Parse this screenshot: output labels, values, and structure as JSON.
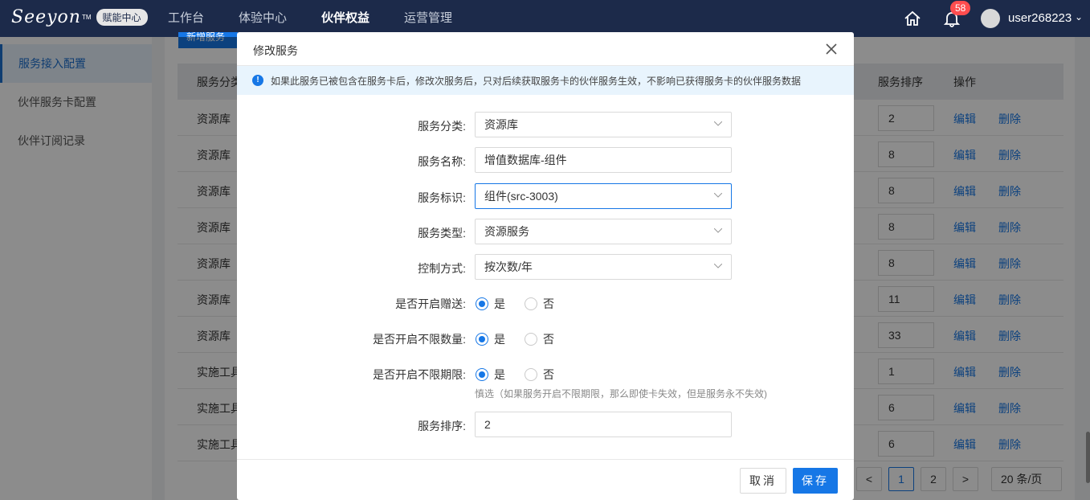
{
  "brand": {
    "logo_text": "Seeyon",
    "tm": "TM",
    "badge": "赋能中心"
  },
  "nav": [
    {
      "label": "工作台"
    },
    {
      "label": "体验中心"
    },
    {
      "label": "伙伴权益"
    },
    {
      "label": "运营管理"
    }
  ],
  "header": {
    "notification_count": "58",
    "username": "user268223"
  },
  "sidebar": {
    "items": [
      {
        "label": "服务接入配置",
        "active": true
      },
      {
        "label": "伙伴服务卡配置"
      },
      {
        "label": "伙伴订阅记录"
      }
    ]
  },
  "page": {
    "add_button": "新增服务",
    "columns": {
      "category": "服务分类",
      "sort": "服务排序",
      "ops": "操作"
    },
    "rows": [
      {
        "category": "资源库",
        "sort": "2"
      },
      {
        "category": "资源库",
        "sort": "8"
      },
      {
        "category": "资源库",
        "sort": "8"
      },
      {
        "category": "资源库",
        "sort": "8"
      },
      {
        "category": "资源库",
        "sort": "8"
      },
      {
        "category": "资源库",
        "sort": "11"
      },
      {
        "category": "资源库",
        "sort": "33"
      },
      {
        "category": "实施工具",
        "sort": "1"
      },
      {
        "category": "实施工具",
        "sort": "6"
      },
      {
        "category": "实施工具",
        "sort": "6"
      }
    ],
    "edit_label": "编辑",
    "delete_label": "删除",
    "pagination": {
      "prev": "<",
      "pages": [
        "1",
        "2"
      ],
      "next": ">",
      "page_size": "20 条/页"
    }
  },
  "modal": {
    "title": "修改服务",
    "alert": "如果此服务已被包含在服务卡后，修改次服务后，只对后续获取服务卡的伙伴服务生效，不影响已获得服务卡的伙伴服务数据",
    "fields": {
      "category": {
        "label": "服务分类:",
        "value": "资源库"
      },
      "name": {
        "label": "服务名称:",
        "value": "增值数据库-组件"
      },
      "identifier": {
        "label": "服务标识:",
        "value": "组件(src-3003)"
      },
      "type": {
        "label": "服务类型:",
        "value": "资源服务"
      },
      "control": {
        "label": "控制方式:",
        "value": "按次数/年"
      },
      "gift": {
        "label": "是否开启赠送:",
        "yes": "是",
        "no": "否",
        "selected": "yes"
      },
      "unlimited_qty": {
        "label": "是否开启不限数量:",
        "yes": "是",
        "no": "否",
        "selected": "yes"
      },
      "unlimited_period": {
        "label": "是否开启不限期限:",
        "yes": "是",
        "no": "否",
        "selected": "yes"
      },
      "period_hint": "慎选（如果服务开启不限期限，那么即使卡失效，但是服务永不失效)",
      "sort": {
        "label": "服务排序:",
        "value": "2"
      }
    },
    "cancel": "取消",
    "save": "保存"
  },
  "colors": {
    "primary": "#1677e6",
    "nav_bg": "#1c2a4a",
    "badge": "#ff4d4f"
  }
}
